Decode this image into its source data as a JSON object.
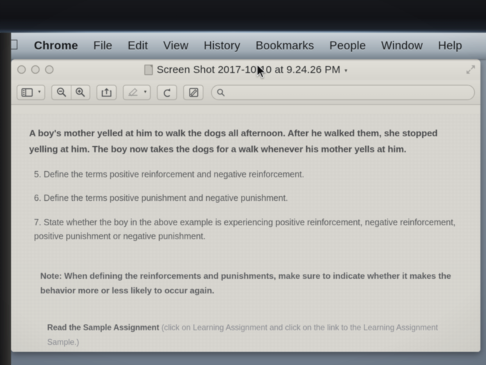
{
  "menubar": {
    "apple_icon": "apple-logo-icon",
    "items": [
      {
        "label": "Chrome",
        "bold": true
      },
      {
        "label": "File",
        "bold": false
      },
      {
        "label": "Edit",
        "bold": false
      },
      {
        "label": "View",
        "bold": false
      },
      {
        "label": "History",
        "bold": false
      },
      {
        "label": "Bookmarks",
        "bold": false
      },
      {
        "label": "People",
        "bold": false
      },
      {
        "label": "Window",
        "bold": false
      },
      {
        "label": "Help",
        "bold": false
      }
    ]
  },
  "window": {
    "title": "Screen Shot 2017-10-10 at 9.24.26 PM",
    "title_caret": "▾",
    "traffic_lights": [
      "close-button",
      "minimize-button",
      "zoom-button"
    ],
    "doc_icon": "document-icon",
    "fullscreen_icon": "fullscreen-arrows-icon"
  },
  "toolbar": {
    "sidebar_icon": "sidebar-toggle-icon",
    "sidebar_caret": "▾",
    "zoom_out_icon": "zoom-out-icon",
    "zoom_in_icon": "zoom-in-icon",
    "share_icon": "share-icon",
    "markup_icon": "markup-pen-icon",
    "markup_caret": "▾",
    "rotate_icon": "rotate-left-icon",
    "annotate_icon": "annotate-pencil-icon",
    "search_icon": "search-icon",
    "search_value": "",
    "search_placeholder": ""
  },
  "document": {
    "intro": "A boy's mother yelled at him to walk the dogs all afternoon. After he walked them, she stopped yelling at him. The boy now takes the dogs for a walk whenever his mother yells at him.",
    "questions": [
      "5. Define the terms positive reinforcement and negative reinforcement.",
      "6. Define the terms positive punishment and negative punishment.",
      "7. State whether the boy in the above example is experiencing positive reinforcement, negative reinforcement, positive punishment or negative punishment."
    ],
    "note": "Note: When defining the reinforcements and punishments, make sure to indicate whether it makes the behavior more or less likely to occur again.",
    "sample_label": "Read the Sample Assignment",
    "sample_hint": "(click on Learning Assignment and click on the link to the Learning Assignment Sample.)"
  },
  "cursor": {
    "icon": "mouse-pointer-icon"
  },
  "colors": {
    "bezel": "#131417",
    "menubar": "#b9c2ca",
    "window_bg": "#d9d7d0",
    "document_bg": "#d8d6cf",
    "desktop": "#7d8996",
    "text_dark": "#3a3b3d",
    "text_body": "#4a4c4e",
    "text_muted": "#81838a"
  }
}
